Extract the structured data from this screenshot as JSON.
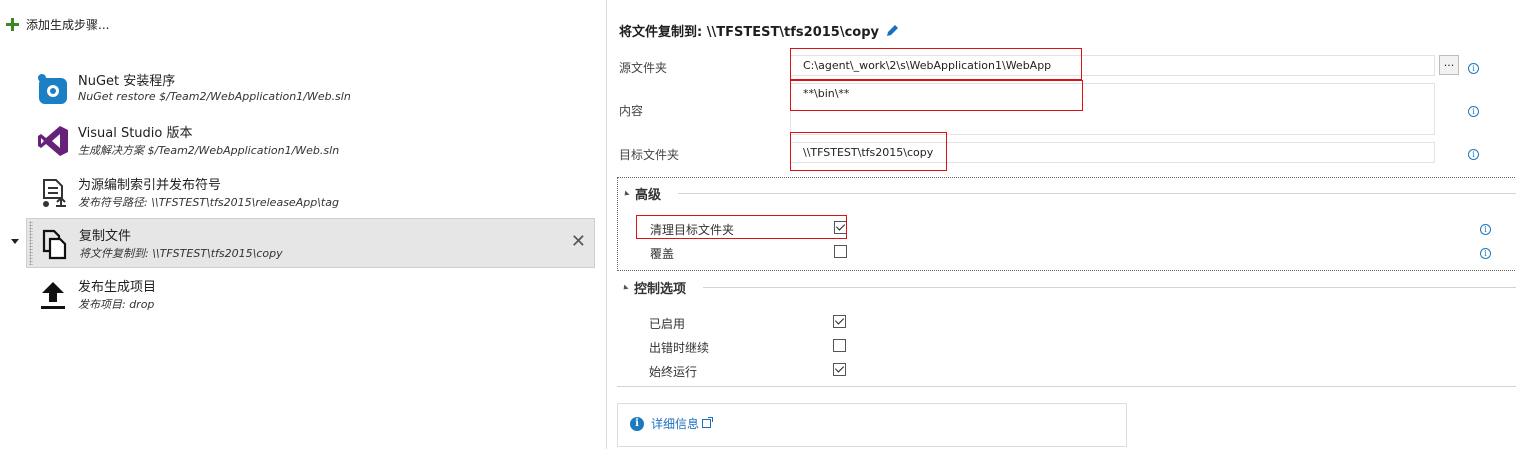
{
  "left": {
    "add_step": "添加生成步骤...",
    "tasks": [
      {
        "name": "NuGet 安装程序",
        "sub": "NuGet restore $/Team2/WebApplication1/Web.sln"
      },
      {
        "name": "Visual Studio 版本",
        "sub": "生成解决方案 $/Team2/WebApplication1/Web.sln"
      },
      {
        "name": "为源编制索引并发布符号",
        "sub": "发布符号路径: \\\\TFSTEST\\tfs2015\\releaseApp\\tag"
      },
      {
        "name": "复制文件",
        "sub": "将文件复制到: \\\\TFSTEST\\tfs2015\\copy"
      },
      {
        "name": "发布生成项目",
        "sub": "发布项目: drop"
      }
    ],
    "close_glyph": "✕"
  },
  "right": {
    "title": "将文件复制到: \\\\TFSTEST\\tfs2015\\copy",
    "fields": {
      "source_label": "源文件夹",
      "source_value": "C:\\agent\\_work\\2\\s\\WebApplication1\\WebApp",
      "browse_label": "...",
      "contents_label": "内容",
      "contents_value": "**\\bin\\**",
      "target_label": "目标文件夹",
      "target_value": "\\\\TFSTEST\\tfs2015\\copy"
    },
    "advanced": {
      "heading": "高级",
      "options": [
        {
          "label": "清理目标文件夹",
          "checked": true
        },
        {
          "label": "覆盖",
          "checked": false
        }
      ]
    },
    "control": {
      "heading": "控制选项",
      "options": [
        {
          "label": "已启用",
          "checked": true
        },
        {
          "label": "出错时继续",
          "checked": false
        },
        {
          "label": "始终运行",
          "checked": true
        }
      ]
    },
    "more_info": "详细信息",
    "info_glyph": "i"
  },
  "colors": {
    "accent": "#1c79c0",
    "highlight": "#dd1111",
    "add_green": "#3a8a1f"
  }
}
